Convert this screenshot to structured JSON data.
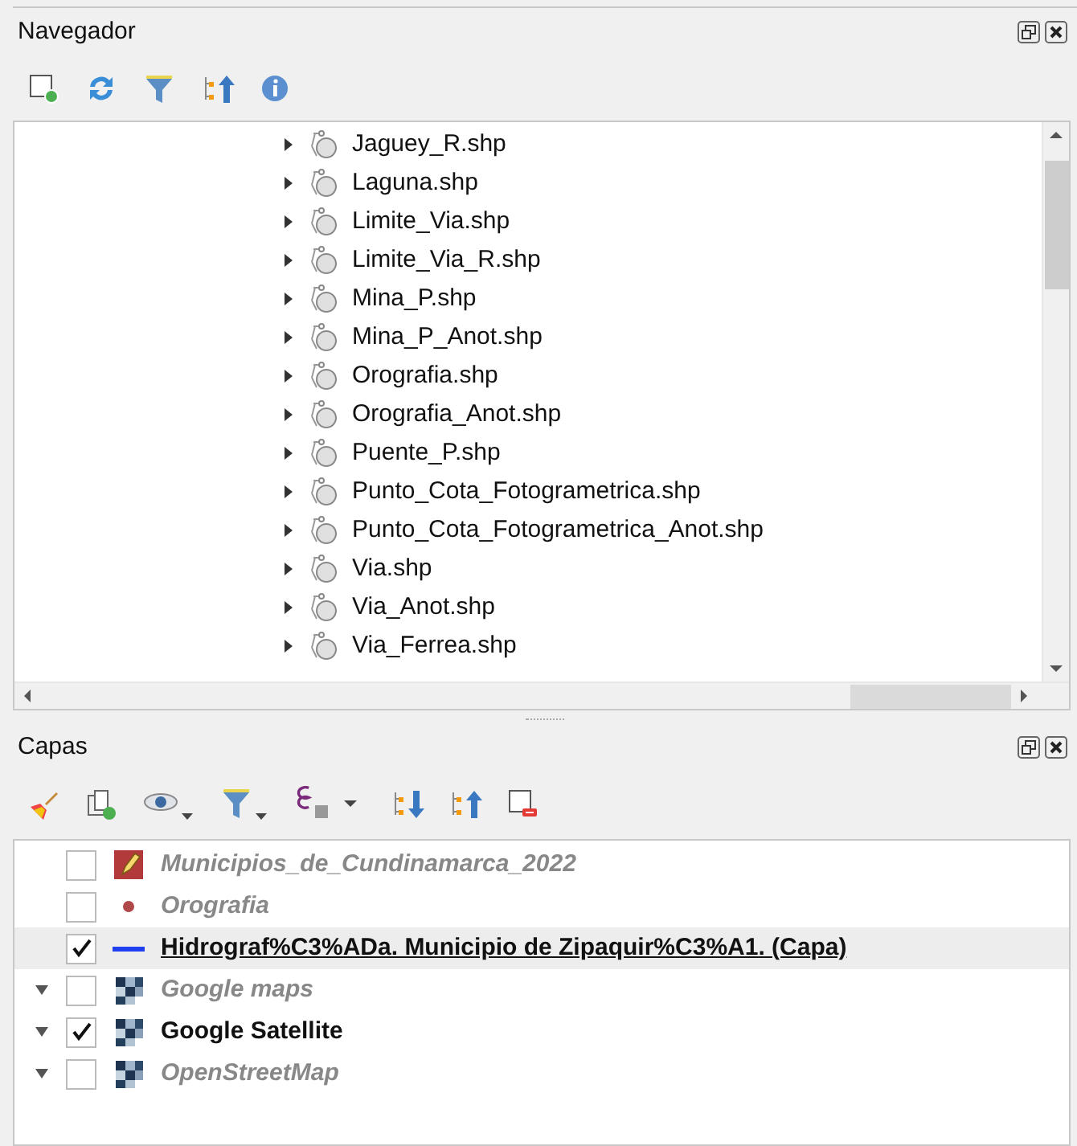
{
  "navigator": {
    "title": "Navegador",
    "files": [
      {
        "name": "Jaguey_R.shp",
        "expanded": false
      },
      {
        "name": "Laguna.shp",
        "expanded": false
      },
      {
        "name": "Limite_Via.shp",
        "expanded": false
      },
      {
        "name": "Limite_Via_R.shp",
        "expanded": false
      },
      {
        "name": "Mina_P.shp",
        "expanded": false
      },
      {
        "name": "Mina_P_Anot.shp",
        "expanded": false
      },
      {
        "name": "Orografia.shp",
        "expanded": false
      },
      {
        "name": "Orografia_Anot.shp",
        "expanded": false
      },
      {
        "name": "Puente_P.shp",
        "expanded": false
      },
      {
        "name": "Punto_Cota_Fotogrametrica.shp",
        "expanded": false
      },
      {
        "name": "Punto_Cota_Fotogrametrica_Anot.shp",
        "expanded": false
      },
      {
        "name": "Via.shp",
        "expanded": false
      },
      {
        "name": "Via_Anot.shp",
        "expanded": false
      },
      {
        "name": "Via_Ferrea.shp",
        "expanded": false
      }
    ]
  },
  "layers_panel": {
    "title": "Capas",
    "layers": [
      {
        "kind": "polygon",
        "name": "Municipios_de_Cundinamarca_2022",
        "checked": false,
        "selected": false
      },
      {
        "kind": "point",
        "name": "Orografia",
        "checked": false,
        "selected": false
      },
      {
        "kind": "line",
        "name": "Hidrograf%C3%ADa. Municipio de Zipaquir%C3%A1. (Capa)",
        "checked": true,
        "selected": true
      },
      {
        "kind": "group",
        "name": "Google maps",
        "checked": false,
        "selected": false,
        "expanded": true
      },
      {
        "kind": "group",
        "name": "Google Satellite",
        "checked": true,
        "selected": false,
        "expanded": true
      },
      {
        "kind": "group",
        "name": "OpenStreetMap",
        "checked": false,
        "selected": false,
        "expanded": true
      }
    ]
  }
}
